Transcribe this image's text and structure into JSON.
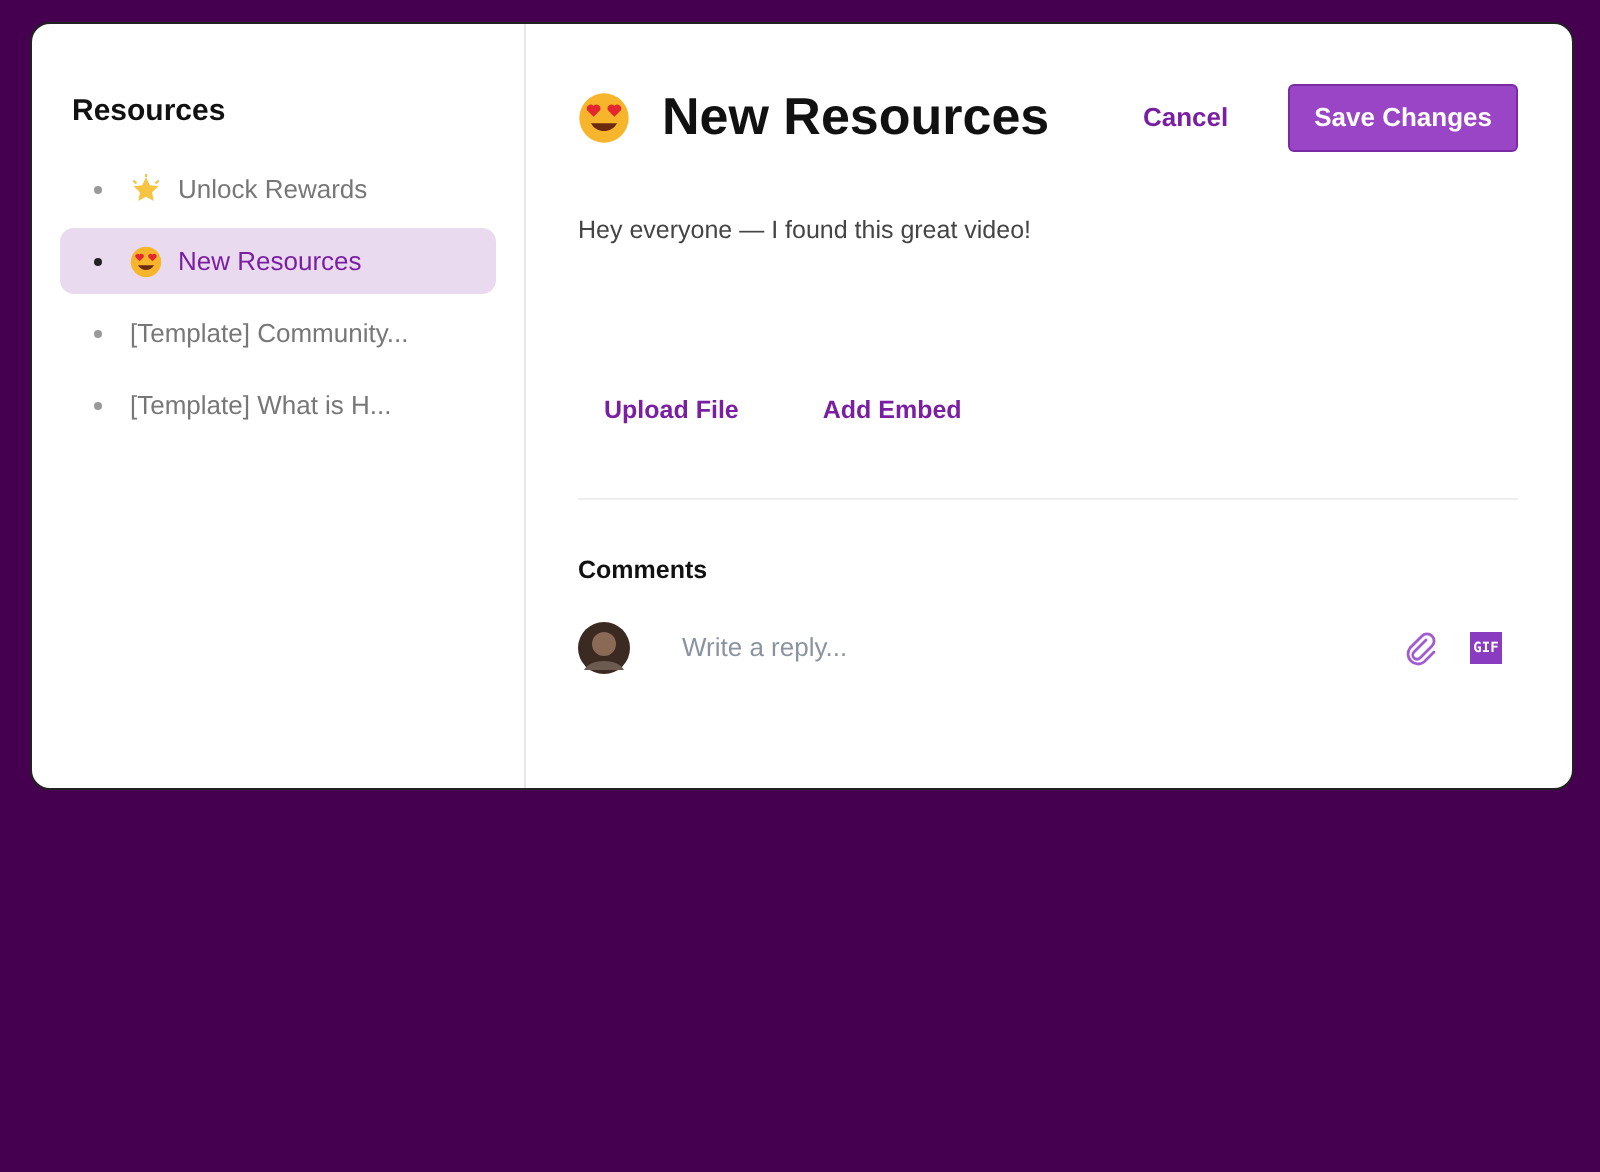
{
  "sidebar": {
    "title": "Resources",
    "items": [
      {
        "label": "Unlock Rewards",
        "kind": "star",
        "selected": false
      },
      {
        "label": "New Resources",
        "kind": "emoji",
        "selected": true
      },
      {
        "label": "[Template] Community...",
        "kind": "plain",
        "selected": false
      },
      {
        "label": "[Template] What is H...",
        "kind": "plain",
        "selected": false
      }
    ]
  },
  "editor": {
    "kind": "emoji",
    "title": "New Resources",
    "cancel": "Cancel",
    "save": "Save Changes",
    "body": "Hey everyone — I found this great video!",
    "actions": [
      "Upload File",
      "Add Embed"
    ]
  },
  "comments": {
    "title": "Comments",
    "placeholder": "Write a reply...",
    "gif": "GIF"
  }
}
